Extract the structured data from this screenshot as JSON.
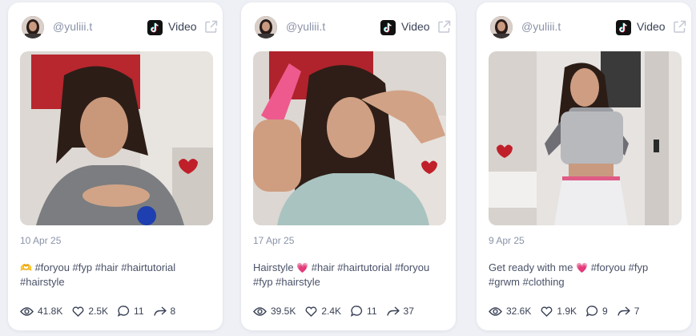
{
  "cards": [
    {
      "username": "@yuliii.t",
      "type_label": "Video",
      "date": "10 Apr 25",
      "caption": {
        "emoji": "🫶",
        "hashtags": "#foryou #fyp #hair #hairtutorial",
        "line2": "#hairstyle"
      },
      "stats": {
        "views": "41.8K",
        "likes": "2.5K",
        "comments": "11",
        "shares": "8"
      }
    },
    {
      "username": "@yuliii.t",
      "type_label": "Video",
      "date": "17 Apr 25",
      "caption": {
        "text": "Hairstyle",
        "emoji": "💗",
        "hashtags": "#hair #hairtutorial #foryou",
        "line2": "#fyp #hairstyle"
      },
      "stats": {
        "views": "39.5K",
        "likes": "2.4K",
        "comments": "11",
        "shares": "37"
      }
    },
    {
      "username": "@yuliii.t",
      "type_label": "Video",
      "date": "9 Apr 25",
      "caption": {
        "text": "Get ready with me",
        "emoji": "💗",
        "hashtags": "#foryou #fyp",
        "line2": "#grwm #clothing"
      },
      "stats": {
        "views": "32.6K",
        "likes": "1.9K",
        "comments": "9",
        "shares": "7"
      }
    }
  ],
  "icons": {
    "platform": "tiktok-icon",
    "external": "external-link-icon",
    "views": "eye-icon",
    "likes": "heart-icon",
    "comments": "comment-icon",
    "shares": "share-icon"
  },
  "colors": {
    "background": "#eef0f5",
    "card": "#ffffff",
    "muted_text": "#8a93a8",
    "text": "#3a4256"
  }
}
